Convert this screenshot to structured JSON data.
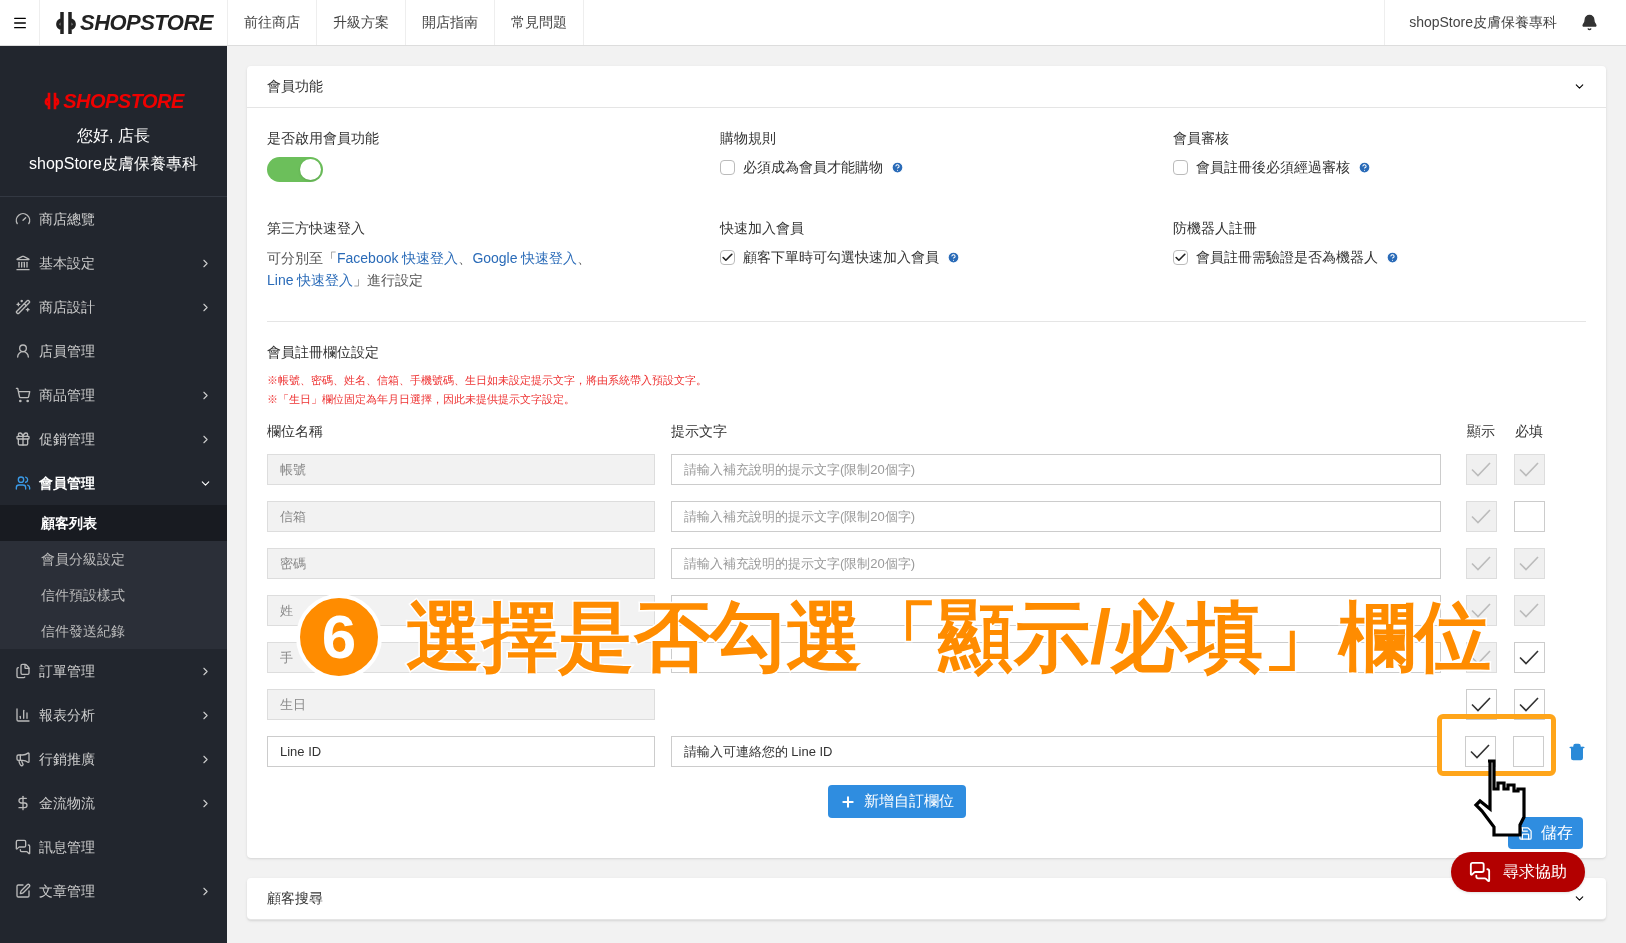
{
  "topbar": {
    "logo": "SHOPSTORE",
    "links": [
      "前往商店",
      "升級方案",
      "開店指南",
      "常見問題"
    ],
    "store_name": "shopStore皮膚保養專科"
  },
  "sidebar": {
    "logo": "SHOPSTORE",
    "greeting": "您好, 店長",
    "store_name": "shopStore皮膚保養專科",
    "items": [
      {
        "label": "商店總覽",
        "has_arrow": false,
        "expanded": false
      },
      {
        "label": "基本設定",
        "has_arrow": true,
        "expanded": false
      },
      {
        "label": "商店設計",
        "has_arrow": true,
        "expanded": false
      },
      {
        "label": "店員管理",
        "has_arrow": false,
        "expanded": false
      },
      {
        "label": "商品管理",
        "has_arrow": true,
        "expanded": false
      },
      {
        "label": "促銷管理",
        "has_arrow": true,
        "expanded": false
      },
      {
        "label": "會員管理",
        "has_arrow": true,
        "expanded": true,
        "children": [
          {
            "label": "顧客列表",
            "selected": true
          },
          {
            "label": "會員分級設定",
            "selected": false
          },
          {
            "label": "信件預設樣式",
            "selected": false
          },
          {
            "label": "信件發送紀錄",
            "selected": false
          }
        ]
      },
      {
        "label": "訂單管理",
        "has_arrow": true,
        "expanded": false
      },
      {
        "label": "報表分析",
        "has_arrow": true,
        "expanded": false
      },
      {
        "label": "行銷推廣",
        "has_arrow": true,
        "expanded": false
      },
      {
        "label": "金流物流",
        "has_arrow": true,
        "expanded": false
      },
      {
        "label": "訊息管理",
        "has_arrow": false,
        "expanded": false
      },
      {
        "label": "文章管理",
        "has_arrow": true,
        "expanded": false
      }
    ]
  },
  "member_card": {
    "title": "會員功能",
    "enable": {
      "label": "是否啟用會員功能",
      "on": true
    },
    "settings": [
      {
        "title": "購物規則",
        "option": "必須成為會員才能購物",
        "checked": false
      },
      {
        "title": "會員審核",
        "option": "會員註冊後必須經過審核",
        "checked": false
      }
    ],
    "third_party": {
      "title": "第三方快速登入",
      "prefix": "可分別至「",
      "links": [
        "Facebook 快速登入",
        "Google 快速登入",
        "Line 快速登入"
      ],
      "separator": "、",
      "suffix": "」進行設定"
    },
    "settings2": [
      {
        "title": "快速加入會員",
        "option": "顧客下單時可勾選快速加入會員",
        "checked": true
      },
      {
        "title": "防機器人註冊",
        "option": "會員註冊需驗證是否為機器人",
        "checked": true
      }
    ],
    "fields_title": "會員註冊欄位設定",
    "notes": [
      "※帳號、密碼、姓名、信箱、手機號碼、生日如未設定提示文字，將由系統帶入預設文字。",
      "※「生日」欄位固定為年月日選擇，因此未提供提示文字設定。"
    ],
    "columns": [
      "欄位名稱",
      "提示文字",
      "顯示",
      "必填"
    ],
    "rows": [
      {
        "name": "帳號",
        "kind": "fixed",
        "placeholder": "請輸入補充說明的提示文字(限制20個字)",
        "show": {
          "checked": true,
          "disabled": true
        },
        "required": {
          "checked": true,
          "disabled": true
        }
      },
      {
        "name": "信箱",
        "kind": "fixed",
        "placeholder": "請輸入補充說明的提示文字(限制20個字)",
        "show": {
          "checked": true,
          "disabled": true
        },
        "required": {
          "checked": false,
          "disabled": false
        }
      },
      {
        "name": "密碼",
        "kind": "fixed",
        "placeholder": "請輸入補充說明的提示文字(限制20個字)",
        "show": {
          "checked": true,
          "disabled": true
        },
        "required": {
          "checked": true,
          "disabled": true
        }
      },
      {
        "name": "姓",
        "kind": "fixed",
        "show": {
          "checked": true,
          "disabled": true
        },
        "required": {
          "checked": true,
          "disabled": true
        }
      },
      {
        "name": "手",
        "kind": "fixed",
        "show": {
          "checked": true,
          "disabled": true
        },
        "required": {
          "checked": true,
          "disabled": false
        }
      },
      {
        "name": "生日",
        "kind": "date",
        "show": {
          "checked": true,
          "disabled": false
        },
        "required": {
          "checked": true,
          "disabled": false
        }
      },
      {
        "name": "Line ID",
        "kind": "custom",
        "value": "請輸入可連絡您的 Line ID",
        "show": {
          "checked": true,
          "disabled": false
        },
        "required": {
          "checked": false,
          "disabled": false
        }
      }
    ],
    "add_button": "新增自訂欄位",
    "save_button": "儲存"
  },
  "search_card": {
    "title": "顧客搜尋"
  },
  "help_button": "尋求協助",
  "annotation": {
    "number": "6",
    "text": "選擇是否勾選「顯示/必填」欄位"
  }
}
